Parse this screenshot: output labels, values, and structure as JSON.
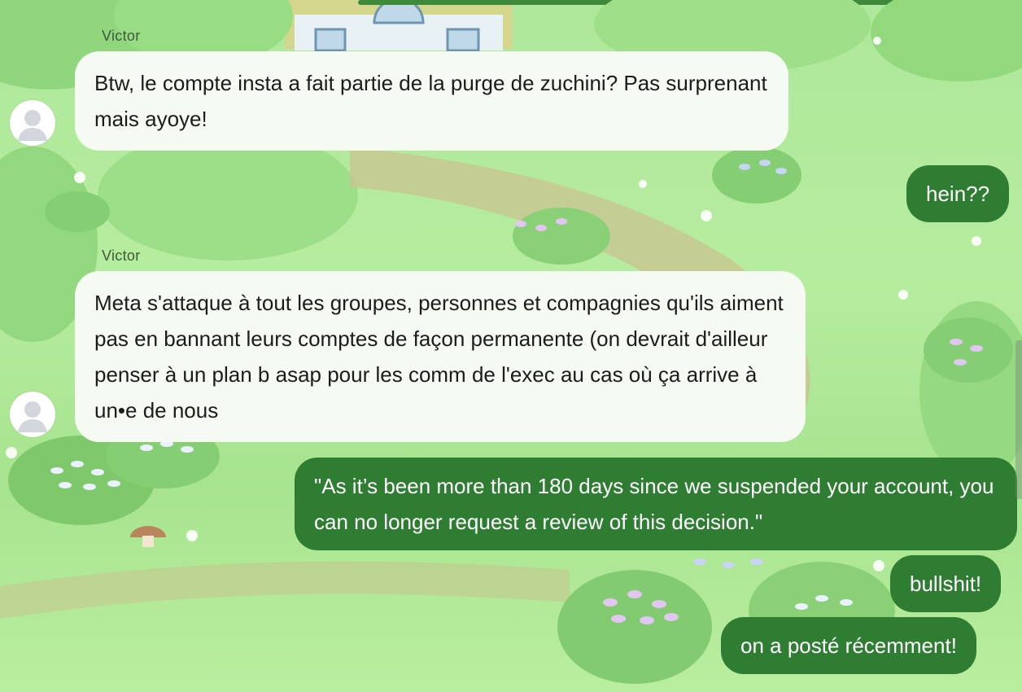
{
  "conversation": {
    "messages": [
      {
        "sender": "Victor",
        "direction": "incoming",
        "text": "Btw, le compte insta a fait partie de la purge de zuchini? Pas surprenant mais ayoye!"
      },
      {
        "direction": "outgoing",
        "text": "hein??"
      },
      {
        "sender": "Victor",
        "direction": "incoming",
        "text": "Meta s'attaque à tout les groupes, personnes et compagnies qu'ils aiment pas en bannant leurs comptes de façon permanente (on devrait d'ailleur penser à un plan b asap pour les comm de l'exec au cas où ça arrive à un•e de nous"
      },
      {
        "direction": "outgoing",
        "text": "\"As it’s been more than 180 days since we suspended your account, you can no longer request a review of this decision.\""
      },
      {
        "direction": "outgoing",
        "text": "bullshit!"
      },
      {
        "direction": "outgoing",
        "text": "on a posté récemment!"
      }
    ]
  },
  "theme": {
    "incoming_bubble": "#f5fbf2",
    "outgoing_bubble": "#2f7d32",
    "background": "#aee89a"
  },
  "icons": {
    "avatar": "default-person-avatar-icon"
  }
}
